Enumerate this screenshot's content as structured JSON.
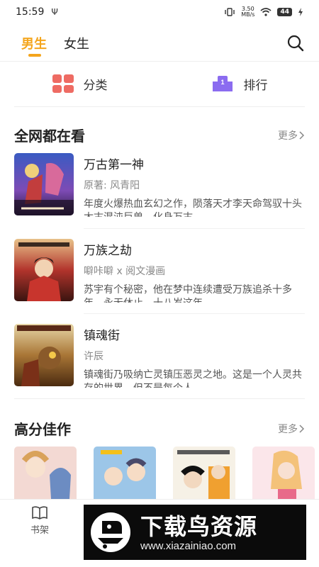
{
  "status_bar": {
    "time": "15:59",
    "usb_symbol": "Ψ",
    "net_speed_value": "3.50",
    "net_speed_unit": "MB/s",
    "battery": "44"
  },
  "top_tabs": [
    {
      "label": "男生",
      "active": true
    },
    {
      "label": "女生",
      "active": false
    }
  ],
  "quick_links": {
    "category": "分类",
    "ranking": "排行",
    "ranking_badge": "1"
  },
  "section_popular": {
    "title": "全网都在看",
    "more": "更多",
    "books": [
      {
        "title": "万古第一神",
        "author": "原著: 风青阳",
        "desc": "年度火爆热血玄幻之作，陨落天才李天命驾驭十头太古混沌巨兽，化身万古…"
      },
      {
        "title": "万族之劫",
        "author": "噼咔噼 x 阅文漫画",
        "desc": "苏宇有个秘密，他在梦中连续遭受万族追杀十多年，永无休止。十八岁这年…"
      },
      {
        "title": "镇魂街",
        "author": "许辰",
        "desc": "镇魂街乃吸纳亡灵镇压恶灵之地。这是一个人灵共存的世界，但不是每个人…"
      }
    ]
  },
  "section_high_score": {
    "title": "高分佳作",
    "more": "更多"
  },
  "bottom_nav": {
    "bookshelf": "书架"
  },
  "watermark": {
    "title": "下载鸟资源",
    "url": "www.xiazainiao.com"
  },
  "colors": {
    "accent": "#f4a51c",
    "category_icon": "#ee6b63",
    "ranking_icon": "#8b6cf0"
  }
}
